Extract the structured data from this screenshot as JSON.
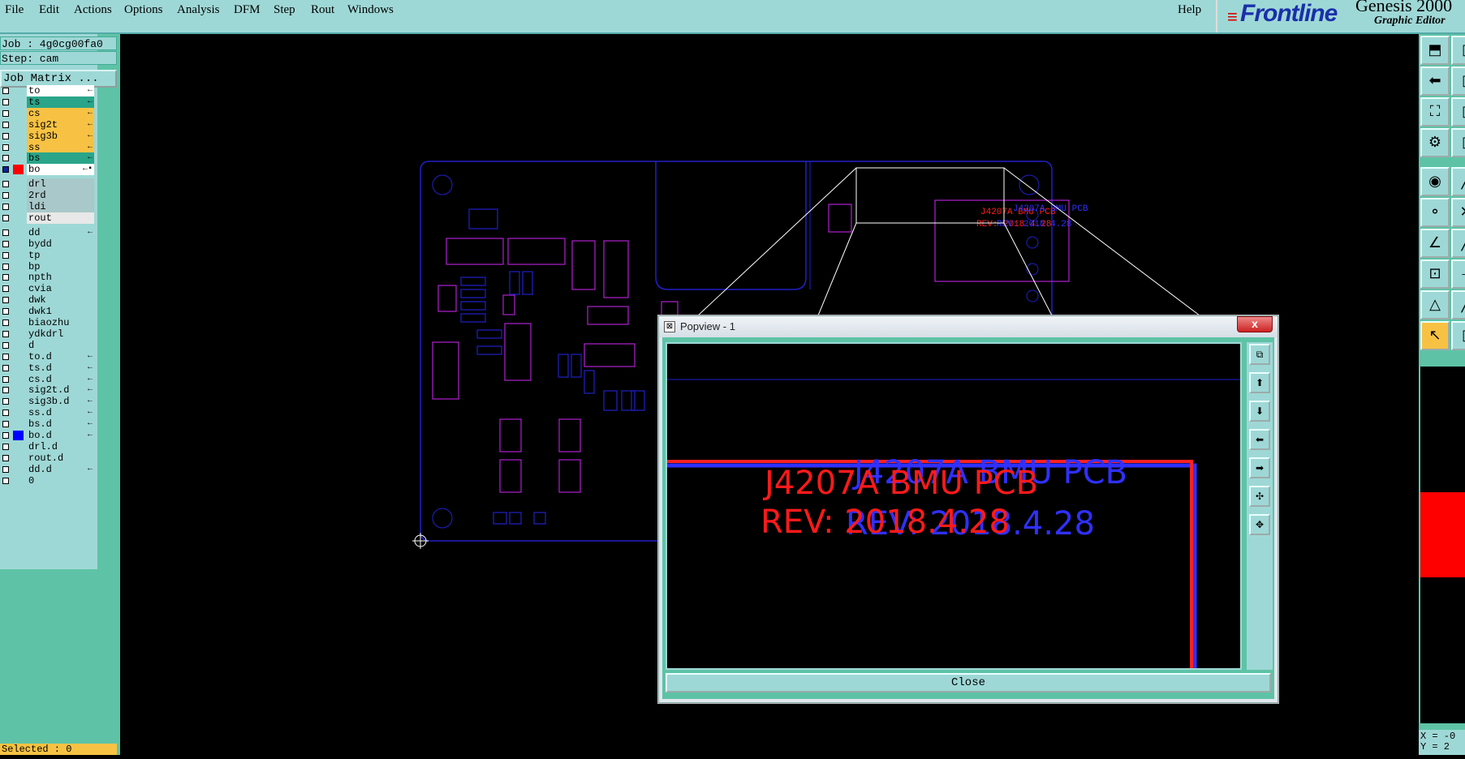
{
  "menu": {
    "items": [
      "File",
      "Edit",
      "Actions",
      "Options",
      "Analysis",
      "DFM",
      "Step",
      "Rout",
      "Windows"
    ],
    "help": "Help"
  },
  "brand": {
    "logo": "Frontline",
    "title": "Genesis 2000",
    "subtitle": "Graphic Editor"
  },
  "left_panel": {
    "job": "Job : 4g0cg00fa0",
    "step": "Step: cam",
    "job_matrix": "Job Matrix ...",
    "selected": "Selected : 0",
    "layers": [
      {
        "name": "to",
        "bg": "#ffffff",
        "color": "",
        "mark": "←"
      },
      {
        "name": "ts",
        "bg": "#2aa58a",
        "color": "",
        "mark": "←"
      },
      {
        "name": "cs",
        "bg": "#f7c243",
        "color": "",
        "mark": "←"
      },
      {
        "name": "sig2t",
        "bg": "#f7c243",
        "color": "",
        "mark": "←"
      },
      {
        "name": "sig3b",
        "bg": "#f7c243",
        "color": "",
        "mark": "←"
      },
      {
        "name": "ss",
        "bg": "#f7c243",
        "color": "",
        "mark": "←"
      },
      {
        "name": "bs",
        "bg": "#2aa58a",
        "color": "",
        "mark": "←"
      },
      {
        "name": "bo",
        "bg": "#ffffff",
        "color": "#ff0000",
        "mark": "←▪",
        "active": true
      },
      {
        "name": "drl",
        "bg": "#a9c8c9",
        "color": "",
        "mark": ""
      },
      {
        "name": "2rd",
        "bg": "#a9c8c9",
        "color": "",
        "mark": ""
      },
      {
        "name": "ldi",
        "bg": "#a9c8c9",
        "color": "",
        "mark": ""
      },
      {
        "name": "rout",
        "bg": "#e8e8e8",
        "color": "",
        "mark": ""
      },
      {
        "name": "dd",
        "bg": "#9ed8d6",
        "color": "",
        "mark": "←"
      },
      {
        "name": "bydd",
        "bg": "#9ed8d6",
        "color": "",
        "mark": ""
      },
      {
        "name": "tp",
        "bg": "#9ed8d6",
        "color": "",
        "mark": ""
      },
      {
        "name": "bp",
        "bg": "#9ed8d6",
        "color": "",
        "mark": ""
      },
      {
        "name": "npth",
        "bg": "#9ed8d6",
        "color": "",
        "mark": ""
      },
      {
        "name": "cvia",
        "bg": "#9ed8d6",
        "color": "",
        "mark": ""
      },
      {
        "name": "dwk",
        "bg": "#9ed8d6",
        "color": "",
        "mark": ""
      },
      {
        "name": "dwk1",
        "bg": "#9ed8d6",
        "color": "",
        "mark": ""
      },
      {
        "name": "biaozhu",
        "bg": "#9ed8d6",
        "color": "",
        "mark": ""
      },
      {
        "name": "ydkdrl",
        "bg": "#9ed8d6",
        "color": "",
        "mark": ""
      },
      {
        "name": "d",
        "bg": "#9ed8d6",
        "color": "",
        "mark": ""
      },
      {
        "name": "to.d",
        "bg": "#9ed8d6",
        "color": "",
        "mark": "←"
      },
      {
        "name": "ts.d",
        "bg": "#9ed8d6",
        "color": "",
        "mark": "←"
      },
      {
        "name": "cs.d",
        "bg": "#9ed8d6",
        "color": "",
        "mark": "←"
      },
      {
        "name": "sig2t.d",
        "bg": "#9ed8d6",
        "color": "",
        "mark": "←"
      },
      {
        "name": "sig3b.d",
        "bg": "#9ed8d6",
        "color": "",
        "mark": "←"
      },
      {
        "name": "ss.d",
        "bg": "#9ed8d6",
        "color": "",
        "mark": "←"
      },
      {
        "name": "bs.d",
        "bg": "#9ed8d6",
        "color": "",
        "mark": "←"
      },
      {
        "name": "bo.d",
        "bg": "#9ed8d6",
        "color": "#0000ff",
        "mark": "←"
      },
      {
        "name": "drl.d",
        "bg": "#9ed8d6",
        "color": "",
        "mark": ""
      },
      {
        "name": "rout.d",
        "bg": "#9ed8d6",
        "color": "",
        "mark": ""
      },
      {
        "name": "dd.d",
        "bg": "#9ed8d6",
        "color": "",
        "mark": "←"
      },
      {
        "name": "0",
        "bg": "#9ed8d6",
        "color": "",
        "mark": ""
      }
    ]
  },
  "popview": {
    "title": "Popview - 1",
    "close_x": "x",
    "close_button": "Close",
    "red_line1": "J4207A   BMU  PCB",
    "red_line2": "REV: 2018.4.28",
    "blue_line1": "J4207A  BMU  PCB",
    "blue_line2": "REV: 2018.4.28"
  },
  "board": {
    "silk_red": "J4207A  BMU PCB",
    "silk_red2": "REV: 2018.4.28",
    "silk_blue": "J4207A  BMU PCB",
    "silk_blue2": "REV: 2018.4.28"
  },
  "coords": {
    "x": "X = -0",
    "y": "Y = 2"
  },
  "colors": {
    "menu_bg": "#9ed8d6",
    "panel_bg": "#5ec3a6",
    "selected_bg": "#f7c243",
    "layer_red": "#ff0000",
    "layer_blue": "#0000ff",
    "outline_blue": "#2020c8",
    "outline_magenta": "#c020c0"
  }
}
